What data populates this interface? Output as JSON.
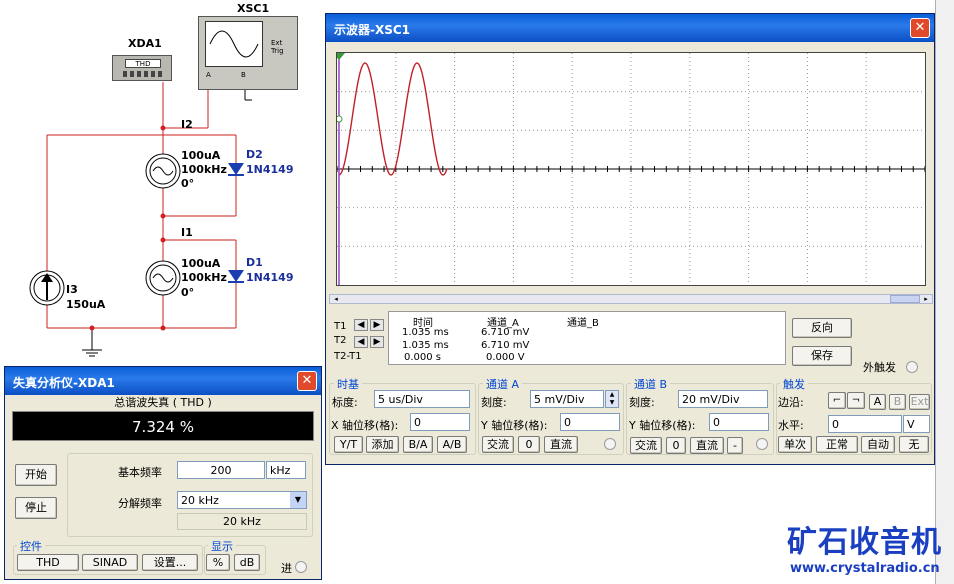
{
  "circuit": {
    "xda_label": "XDA1",
    "xda_screen": "THD",
    "xsc_label": "XSC1",
    "xsc_ext": "Ext Trig",
    "xsc_a": "A",
    "xsc_b": "B",
    "node_i2": "I2",
    "node_i1": "I1",
    "src_top_amp": "100uA",
    "src_top_freq": "100kHz",
    "src_top_phase": "0°",
    "diode_d2": "D2",
    "diode_d2_part": "1N4149",
    "src_bot_amp": "100uA",
    "src_bot_freq": "100kHz",
    "src_bot_phase": "0°",
    "diode_d1": "D1",
    "diode_d1_part": "1N4149",
    "src_i3": "I3",
    "src_i3_val": "150uA"
  },
  "scope": {
    "title": "示波器-XSC1",
    "cursor_t1": "T1",
    "cursor_t2": "T2",
    "cursor_t2t1": "T2-T1",
    "hdr_time": "时间",
    "hdr_cha": "通道_A",
    "hdr_chb": "通道_B",
    "t1_time": "1.035 ms",
    "t1_a": "6.710 mV",
    "t2_time": "1.035 ms",
    "t2_a": "6.710 mV",
    "dt_time": "0.000 s",
    "dt_a": "0.000 V",
    "reverse_btn": "反向",
    "save_btn": "保存",
    "ext_trig_label": "外触发",
    "timebase": {
      "title": "时基",
      "scale_label": "标度:",
      "scale_value": "5 us/Div",
      "xpos_label": "X 轴位移(格):",
      "xpos_value": "0",
      "btn_yt": "Y/T",
      "btn_add": "添加",
      "btn_ba": "B/A",
      "btn_ab": "A/B"
    },
    "channel_a": {
      "title": "通道 A",
      "scale_label": "刻度:",
      "scale_value": "5 mV/Div",
      "ypos_label": "Y 轴位移(格):",
      "ypos_value": "0",
      "btn_ac": "交流",
      "btn_zero": "0",
      "btn_dc": "直流"
    },
    "channel_b": {
      "title": "通道 B",
      "scale_label": "刻度:",
      "scale_value": "20 mV/Div",
      "ypos_label": "Y 轴位移(格):",
      "ypos_value": "0",
      "btn_ac": "交流",
      "btn_zero": "0",
      "btn_dc": "直流",
      "btn_minus": "-"
    },
    "trigger": {
      "title": "触发",
      "edge_label": "边沿:",
      "level_label": "水平:",
      "level_value": "0",
      "level_unit": "V",
      "btn_a": "A",
      "btn_b": "B",
      "btn_ext": "Ext",
      "btn_single": "单次",
      "btn_normal": "正常",
      "btn_auto": "自动",
      "btn_none": "无"
    }
  },
  "distortion": {
    "title": "失真分析仪-XDA1",
    "header": "总谐波失真 ( THD )",
    "value": "7.324 %",
    "start_btn": "开始",
    "stop_btn": "停止",
    "fund_label": "基本频率",
    "fund_value": "200",
    "fund_unit": "kHz",
    "res_label": "分解频率",
    "res_value": "20 kHz",
    "res_readout": "20 kHz",
    "ctrl_title": "控件",
    "btn_thd": "THD",
    "btn_sinad": "SINAD",
    "btn_settings": "设置...",
    "disp_title": "显示",
    "btn_pct": "%",
    "btn_db": "dB",
    "enter_label": "进"
  },
  "watermark": {
    "cn": "矿石收音机",
    "url": "www.crystalradio.cn"
  },
  "colors": {
    "accent": "#0a5fd8",
    "wave": "#c0202a",
    "cursor": "#9a3ec8",
    "thd_bg": "#000000",
    "label_blue": "#1a2f9c"
  }
}
